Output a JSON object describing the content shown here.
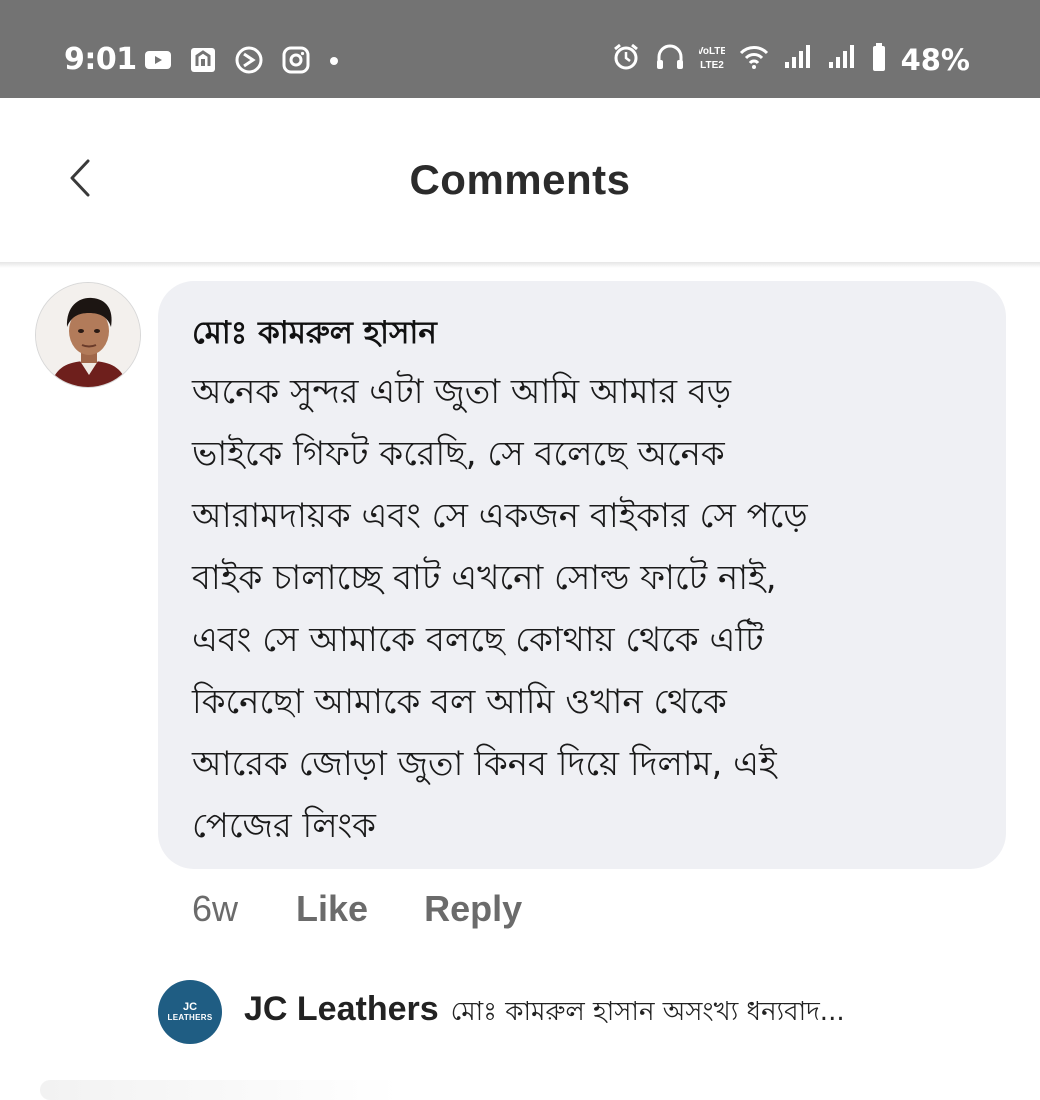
{
  "status_bar": {
    "time": "9:01",
    "battery": "48%",
    "left_icons": [
      "youtube-icon",
      "nfc-icon",
      "sync-icon",
      "instagram-icon",
      "notification-dot"
    ],
    "right_icons": [
      "alarm-icon",
      "headphones-icon",
      "volte-icon",
      "wifi-icon",
      "signal-1-icon",
      "signal-2-icon",
      "battery-icon"
    ],
    "bg_color": "#737373"
  },
  "header": {
    "title": "Comments"
  },
  "comment": {
    "author": "মোঃ কামরুল হাসান",
    "lines": [
      "অনেক সুন্দর এটা জুতা আমি আমার বড়",
      "ভাইকে গিফট করেছি, সে বলেছে অনেক",
      "আরামদায়ক এবং সে একজন বাইকার সে পড়ে",
      "বাইক চালাচ্ছে বাট এখনো সোল্ড ফাটে নাই,",
      "এবং সে আমাকে বলছে কোথায় থেকে এটি",
      "কিনেছো আমাকে বল আমি ওখান থেকে",
      "আরেক জোড়া জুতা কিনব দিয়ে দিলাম, এই",
      "পেজের লিংক"
    ],
    "time_ago": "6w",
    "like_label": "Like",
    "reply_label": "Reply",
    "bubble_color": "#eff0f4"
  },
  "reply_preview": {
    "avatar_text_top": "JC",
    "avatar_text_bottom": "LEATHERS",
    "author": "JC Leathers",
    "snippet": "মোঃ কামরুল হাসান অসংখ্য ধন্যবাদ...",
    "avatar_color": "#1f5d83"
  }
}
